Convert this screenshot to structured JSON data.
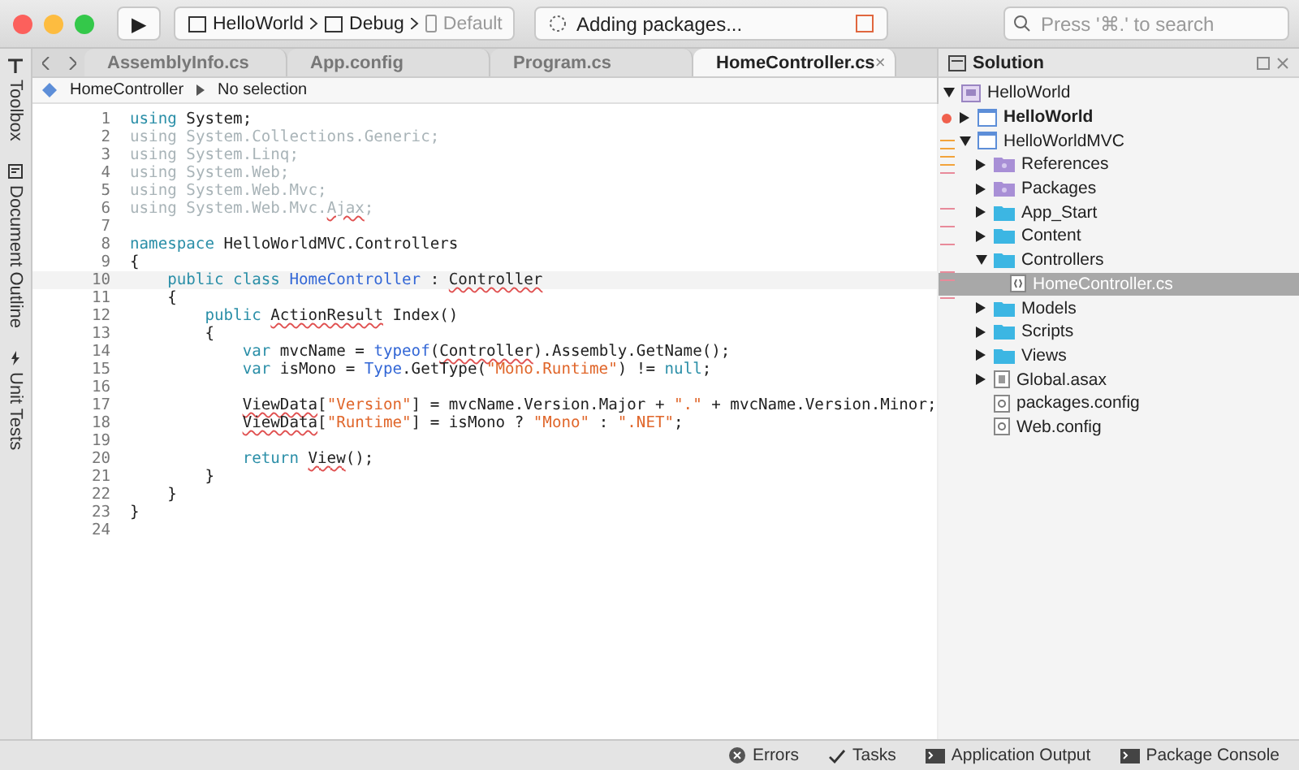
{
  "toolbar": {
    "run_button": "▶",
    "project": "HelloWorld",
    "configuration": "Debug",
    "device": "Default",
    "status": "Adding packages...",
    "search": {
      "placeholder": "Press '⌘.' to search"
    }
  },
  "side_pads": [
    "Toolbox",
    "Document Outline",
    "Unit Tests"
  ],
  "tabs": [
    {
      "label": "AssemblyInfo.cs",
      "selected": false
    },
    {
      "label": "App.config",
      "selected": false
    },
    {
      "label": "Program.cs",
      "selected": false
    },
    {
      "label": "HomeController.cs",
      "selected": true,
      "close": "×"
    }
  ],
  "breadcrumb": {
    "class": "HomeController",
    "member": "No selection"
  },
  "code": [
    {
      "n": "1",
      "faded": false,
      "tokens": [
        {
          "t": "using",
          "kind": "keyword"
        },
        {
          "t": " System;",
          "kind": "plain"
        }
      ]
    },
    {
      "n": "2",
      "faded": true,
      "tokens": [
        {
          "t": "using",
          "kind": "keyword"
        },
        {
          "t": " System.Collections.Generic;",
          "kind": "plain"
        }
      ]
    },
    {
      "n": "3",
      "faded": true,
      "tokens": [
        {
          "t": "using",
          "kind": "keyword"
        },
        {
          "t": " System.Linq;",
          "kind": "plain"
        }
      ]
    },
    {
      "n": "4",
      "faded": true,
      "tokens": [
        {
          "t": "using",
          "kind": "keyword"
        },
        {
          "t": " System.Web;",
          "kind": "plain"
        }
      ]
    },
    {
      "n": "5",
      "faded": true,
      "tokens": [
        {
          "t": "using",
          "kind": "keyword"
        },
        {
          "t": " System.Web.Mvc;",
          "kind": "plain"
        }
      ]
    },
    {
      "n": "6",
      "faded": true,
      "tokens": [
        {
          "t": "using",
          "kind": "keyword"
        },
        {
          "t": " System.Web.Mvc.",
          "kind": "plain"
        },
        {
          "t": "Ajax",
          "kind": "plain",
          "error": true
        },
        {
          "t": ";",
          "kind": "plain"
        }
      ]
    },
    {
      "n": "7"
    },
    {
      "n": "8",
      "faded": false,
      "tokens": [
        {
          "t": "namespace",
          "kind": "keyword"
        },
        {
          "t": " HelloWorldMVC.Controllers",
          "kind": "plain"
        }
      ]
    },
    {
      "n": "9",
      "faded": false,
      "tokens": [
        {
          "t": "{",
          "kind": "plain"
        }
      ]
    },
    {
      "n": "10",
      "faded": false,
      "current": true,
      "tokens": [
        {
          "t": "    public class ",
          "kind": "keyword"
        },
        {
          "t": "HomeController",
          "kind": "type"
        },
        {
          "t": " : ",
          "kind": "plain"
        },
        {
          "t": "Controller",
          "kind": "plain",
          "error": true
        }
      ]
    },
    {
      "n": "11",
      "faded": false,
      "tokens": [
        {
          "t": "    {",
          "kind": "plain"
        }
      ]
    },
    {
      "n": "12",
      "faded": false,
      "tokens": [
        {
          "t": "        public ",
          "kind": "keyword"
        },
        {
          "t": "ActionResult",
          "kind": "plain",
          "error": true
        },
        {
          "t": " Index()",
          "kind": "plain"
        }
      ]
    },
    {
      "n": "13",
      "faded": false,
      "tokens": [
        {
          "t": "        {",
          "kind": "plain"
        }
      ]
    },
    {
      "n": "14",
      "faded": false,
      "tokens": [
        {
          "t": "            var",
          "kind": "keyword"
        },
        {
          "t": " mvcName = ",
          "kind": "plain"
        },
        {
          "t": "typeof",
          "kind": "type"
        },
        {
          "t": "(",
          "kind": "plain"
        },
        {
          "t": "Controller",
          "kind": "plain",
          "error": true
        },
        {
          "t": ").Assembly.GetName();",
          "kind": "plain"
        }
      ]
    },
    {
      "n": "15",
      "faded": false,
      "tokens": [
        {
          "t": "            var",
          "kind": "keyword"
        },
        {
          "t": " isMono = ",
          "kind": "plain"
        },
        {
          "t": "Type",
          "kind": "type"
        },
        {
          "t": ".GetType(",
          "kind": "plain"
        },
        {
          "t": "\"Mono.Runtime\"",
          "kind": "string"
        },
        {
          "t": ") != ",
          "kind": "plain"
        },
        {
          "t": "null",
          "kind": "keyword"
        },
        {
          "t": ";",
          "kind": "plain"
        }
      ]
    },
    {
      "n": "16"
    },
    {
      "n": "17",
      "faded": false,
      "tokens": [
        {
          "t": "            ViewData",
          "kind": "plain",
          "error": true
        },
        {
          "t": "[",
          "kind": "plain"
        },
        {
          "t": "\"Version\"",
          "kind": "string"
        },
        {
          "t": "] = mvcName.Version.Major + ",
          "kind": "plain"
        },
        {
          "t": "\".\"",
          "kind": "string"
        },
        {
          "t": " + mvcName.Version.Minor;",
          "kind": "plain"
        }
      ]
    },
    {
      "n": "18",
      "faded": false,
      "tokens": [
        {
          "t": "            ViewData",
          "kind": "plain",
          "error": true
        },
        {
          "t": "[",
          "kind": "plain"
        },
        {
          "t": "\"Runtime\"",
          "kind": "string"
        },
        {
          "t": "] = isMono ? ",
          "kind": "plain"
        },
        {
          "t": "\"Mono\"",
          "kind": "string"
        },
        {
          "t": " : ",
          "kind": "plain"
        },
        {
          "t": "\".NET\"",
          "kind": "string"
        },
        {
          "t": ";",
          "kind": "plain"
        }
      ]
    },
    {
      "n": "19"
    },
    {
      "n": "20",
      "faded": false,
      "tokens": [
        {
          "t": "            return ",
          "kind": "keyword"
        },
        {
          "t": "View",
          "kind": "plain",
          "error": true
        },
        {
          "t": "();",
          "kind": "plain"
        }
      ]
    },
    {
      "n": "21",
      "faded": false,
      "tokens": [
        {
          "t": "        }",
          "kind": "plain"
        }
      ]
    },
    {
      "n": "22",
      "faded": false,
      "tokens": [
        {
          "t": "    }",
          "kind": "plain"
        }
      ]
    },
    {
      "n": "23",
      "faded": false,
      "tokens": [
        {
          "t": "}",
          "kind": "plain"
        }
      ]
    },
    {
      "n": "24"
    }
  ],
  "solution": {
    "title": "Solution",
    "tree": [
      {
        "label": "HelloWorld",
        "kind": "solution",
        "expanded": true,
        "bold": false,
        "selected": false,
        "children": [
          {
            "label": "HelloWorld",
            "kind": "project",
            "expanded": false,
            "bold": true,
            "selected": false
          },
          {
            "label": "HelloWorldMVC",
            "kind": "project",
            "expanded": true,
            "bold": false,
            "selected": false,
            "children": [
              {
                "label": "References",
                "kind": "special-folder",
                "expanded": false,
                "bold": false,
                "selected": false
              },
              {
                "label": "Packages",
                "kind": "special-folder",
                "expanded": false,
                "bold": false,
                "selected": false
              },
              {
                "label": "App_Start",
                "kind": "folder",
                "expanded": false,
                "bold": false,
                "selected": false
              },
              {
                "label": "Content",
                "kind": "folder",
                "expanded": false,
                "bold": false,
                "selected": false
              },
              {
                "label": "Controllers",
                "kind": "folder",
                "expanded": true,
                "bold": false,
                "selected": false,
                "children": [
                  {
                    "label": "HomeController.cs",
                    "kind": "file",
                    "bold": false,
                    "selected": true
                  }
                ]
              },
              {
                "label": "Models",
                "kind": "folder",
                "expanded": false,
                "bold": false,
                "selected": false
              },
              {
                "label": "Scripts",
                "kind": "folder",
                "expanded": false,
                "bold": false,
                "selected": false
              },
              {
                "label": "Views",
                "kind": "folder",
                "expanded": false,
                "bold": false,
                "selected": false
              },
              {
                "label": "Global.asax",
                "kind": "asax",
                "expanded": false,
                "bold": false,
                "selected": false
              },
              {
                "label": "packages.config",
                "kind": "config",
                "bold": false,
                "selected": false
              },
              {
                "label": "Web.config",
                "kind": "config",
                "bold": false,
                "selected": false
              }
            ]
          }
        ]
      }
    ]
  },
  "status_bar": [
    {
      "label": "Errors",
      "kind": "error"
    },
    {
      "label": "Tasks",
      "kind": "check"
    },
    {
      "label": "Application Output",
      "kind": "terminal"
    },
    {
      "label": "Package Console",
      "kind": "terminal"
    }
  ]
}
